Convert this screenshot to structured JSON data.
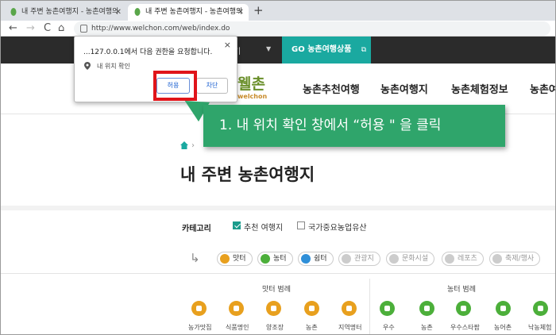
{
  "browser": {
    "tabs": [
      {
        "title": "내 주변 농촌여행지 - 농촌여행의"
      },
      {
        "title": "내 주변 농촌여행지 - 농촌여행의"
      }
    ],
    "new_tab": "+",
    "url": "http://www.welchon.com/web/index.do",
    "nav": {
      "back": "←",
      "forward": "→",
      "reload": "C",
      "home": "⌂"
    }
  },
  "topnav": {
    "item": "기",
    "go_button": "GO 농촌여행상품"
  },
  "logo": {
    "text": "웰촌",
    "sub": "welchon"
  },
  "menu": [
    "농촌추천여행",
    "농촌여행지",
    "농촌체험정보",
    "농촌여"
  ],
  "page_title": "내 주변 농촌여행지",
  "category": {
    "label": "카테고리",
    "options": [
      {
        "label": "추천 여행지",
        "checked": true
      },
      {
        "label": "국가중요농업유산",
        "checked": false
      }
    ]
  },
  "filters": [
    {
      "label": "맛터",
      "color": "#e8a01e",
      "active": true
    },
    {
      "label": "농터",
      "color": "#4caf3a",
      "active": true
    },
    {
      "label": "쉼터",
      "color": "#2f8fd8",
      "active": true
    },
    {
      "label": "관광지",
      "active": false
    },
    {
      "label": "문화시설",
      "active": false
    },
    {
      "label": "레포츠",
      "active": false
    },
    {
      "label": "축제/행사",
      "active": false
    }
  ],
  "sections": [
    {
      "title": "맛터 범례",
      "items": [
        "농가맛집",
        "식품명인",
        "양조장",
        "농촌",
        "지역명터"
      ],
      "color": "#e8a01e"
    },
    {
      "title": "농터 범례",
      "items": [
        "우수",
        "농촌",
        "우수스타팜",
        "농어촌",
        "낙농체험"
      ],
      "color": "#4caf3a"
    }
  ],
  "permission_popup": {
    "message": "...127.0.0.1에서 다음 권한을 요청합니다.",
    "location": "내 위치 확인",
    "allow": "허용",
    "block": "차단",
    "close": "×"
  },
  "callout": {
    "text": "1. 내 위치 확인 창에서 “허용 \" 을 클릭"
  }
}
